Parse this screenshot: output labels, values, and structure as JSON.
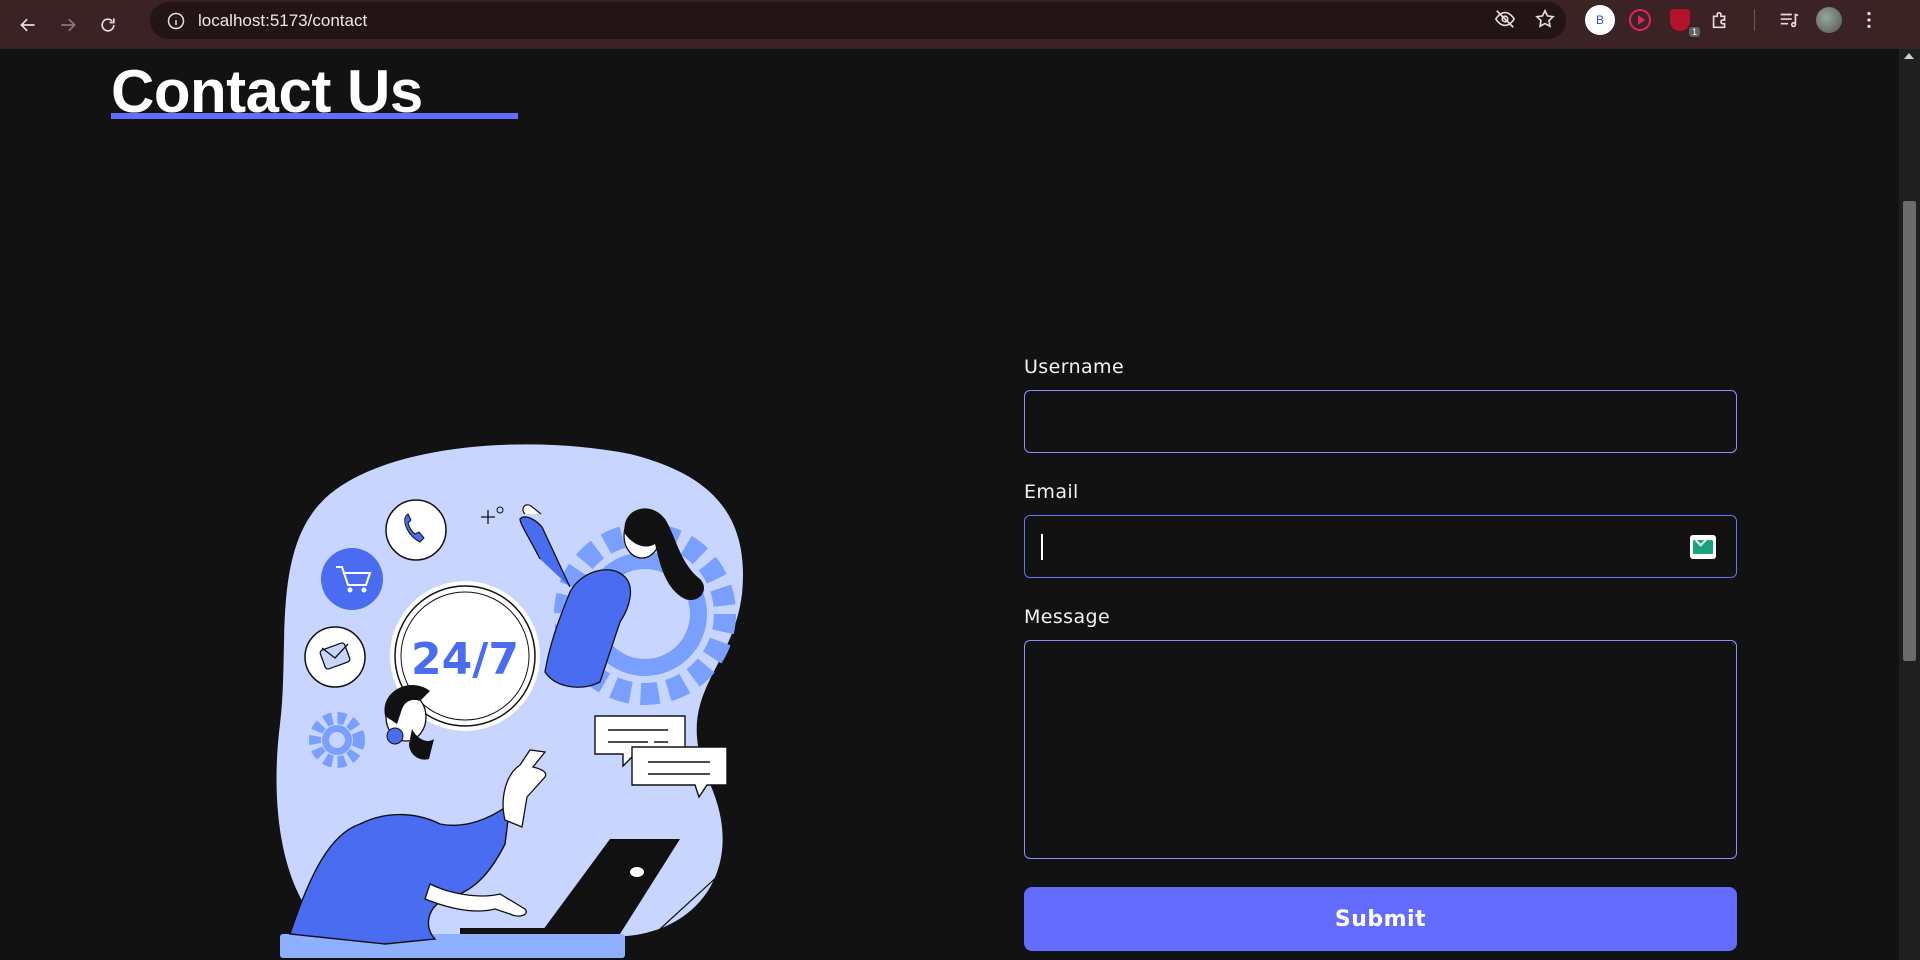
{
  "browser": {
    "url": "localhost:5173/contact",
    "extension_b_label": "B",
    "extension_badge": "1"
  },
  "page": {
    "title": "Contact Us",
    "illustration_text": "24/7",
    "accent_color": "#646cff"
  },
  "form": {
    "username_label": "Username",
    "username_value": "",
    "email_label": "Email",
    "email_value": "",
    "message_label": "Message",
    "message_value": "",
    "submit_label": "Submit"
  }
}
